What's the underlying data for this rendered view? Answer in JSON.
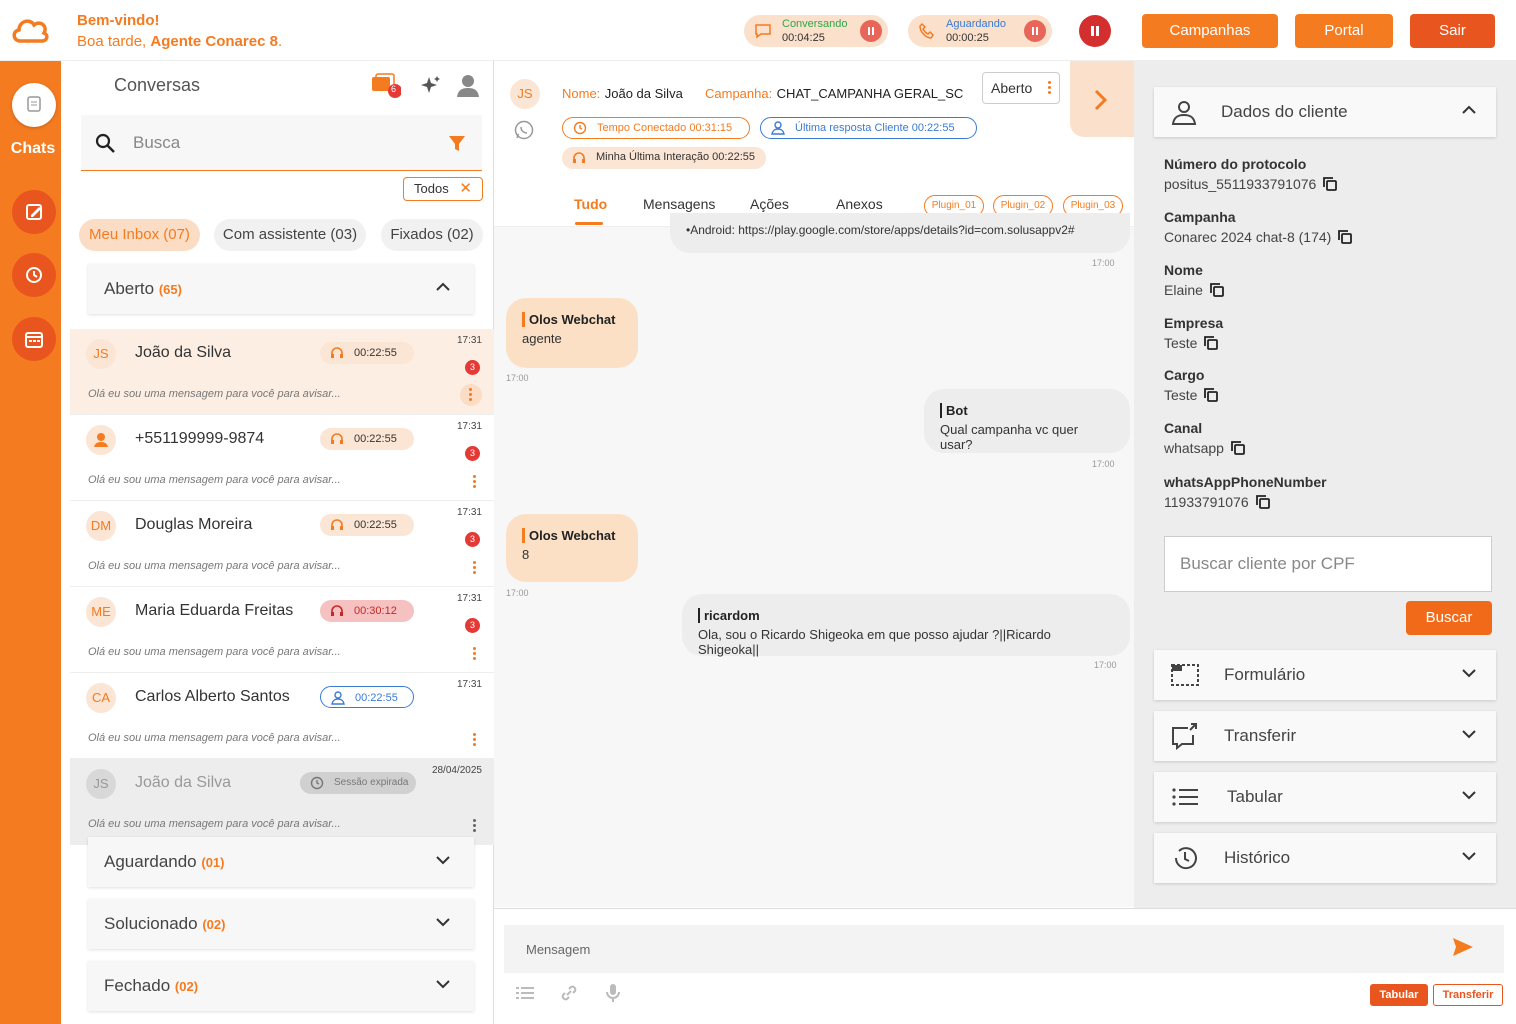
{
  "header": {
    "welcome": "Bem-vindo!",
    "greeting_prefix": "Boa tarde, ",
    "agent_name": "Agente Conarec 8",
    "greeting_suffix": ".",
    "status_chatting_label": "Conversando",
    "status_chatting_time": "00:04:25",
    "status_waiting_label": "Aguardando",
    "status_waiting_time": "00:00:25",
    "btn_campaigns": "Campanhas",
    "btn_portal": "Portal",
    "btn_exit": "Sair"
  },
  "rail": {
    "chats_label": "Chats"
  },
  "conversations": {
    "title": "Conversas",
    "notif_count": "6",
    "search_placeholder": "Busca",
    "filter_chip": "Todos",
    "tabs": [
      "Meu Inbox (07)",
      "Com assistente (03)",
      "Fixados (02)"
    ],
    "sections": [
      {
        "label": "Aberto",
        "count": "(65)"
      },
      {
        "label": "Aguardando",
        "count": "(01)"
      },
      {
        "label": "Solucionado",
        "count": "(02)"
      },
      {
        "label": "Fechado",
        "count": "(02)"
      }
    ],
    "items": [
      {
        "initials": "JS",
        "name": "João da Silva",
        "timer": "00:22:55",
        "time": "17:31",
        "badge": "3",
        "msg": "Olá eu sou uma mensagem para você para avisar..."
      },
      {
        "initials": "",
        "name": "+551199999-9874",
        "timer": "00:22:55",
        "time": "17:31",
        "badge": "3",
        "msg": "Olá eu sou uma mensagem para você para avisar..."
      },
      {
        "initials": "DM",
        "name": "Douglas Moreira",
        "timer": "00:22:55",
        "time": "17:31",
        "badge": "3",
        "msg": "Olá eu sou uma mensagem para você para avisar..."
      },
      {
        "initials": "ME",
        "name": "Maria Eduarda Freitas",
        "timer": "00:30:12",
        "time": "17:31",
        "badge": "3",
        "msg": "Olá eu sou uma mensagem para você para avisar..."
      },
      {
        "initials": "CA",
        "name": "Carlos Alberto Santos",
        "timer": "00:22:55",
        "time": "17:31",
        "badge": "",
        "msg": "Olá eu sou uma mensagem para você para avisar..."
      },
      {
        "initials": "JS",
        "name": "João da Silva",
        "timer": "Sessão expirada",
        "time": "28/04/2025",
        "badge": "",
        "msg": "Olá eu sou uma mensagem para você para avisar..."
      }
    ]
  },
  "chat": {
    "initials": "JS",
    "name_label": "Nome:",
    "name_value": "João da Silva",
    "campaign_label": "Campanha:",
    "campaign_value": "CHAT_CAMPANHA GERAL_SC",
    "status": "Aberto",
    "pill_connected": "Tempo Conectado 00:31:15",
    "pill_last_reply": "Última resposta Cliente 00:22:55",
    "pill_last_interaction": "Minha Última Interação 00:22:55",
    "tabs": [
      "Tudo",
      "Mensagens",
      "Ações",
      "Anexos"
    ],
    "plugins": [
      "Plugin_01",
      "Plugin_02",
      "Plugin_03"
    ],
    "top_cut_text": "•Android: https://play.google.com/store/apps/details?id=com.solusappv2#",
    "messages": [
      {
        "sender": "Olos Webchat",
        "text": "agente",
        "time": "17:00"
      },
      {
        "sender": "Bot",
        "text": "Qual campanha vc quer usar?",
        "time": "17:00"
      },
      {
        "sender": "Olos Webchat",
        "text": "8",
        "time": "17:00"
      },
      {
        "sender": "ricardom",
        "text": "Ola, sou o Ricardo Shigeoka em que posso ajudar ?||Ricardo Shigeoka||",
        "time": "17:00"
      }
    ],
    "first_time": "17:00",
    "composer_placeholder": "Mensagem",
    "btn_tabular": "Tabular",
    "btn_transferir": "Transferir"
  },
  "client": {
    "title": "Dados do cliente",
    "fields": [
      {
        "label": "Número do protocolo",
        "value": "positus_5511933791076"
      },
      {
        "label": "Campanha",
        "value": "Conarec 2024 chat-8 (174)"
      },
      {
        "label": "Nome",
        "value": "Elaine"
      },
      {
        "label": "Empresa",
        "value": "Teste"
      },
      {
        "label": "Cargo",
        "value": "Teste"
      },
      {
        "label": "Canal",
        "value": "whatsapp"
      },
      {
        "label": "whatsAppPhoneNumber",
        "value": "11933791076"
      }
    ],
    "cpf_placeholder": "Buscar cliente por CPF",
    "btn_search": "Buscar",
    "sections": [
      "Formulário",
      "Transferir",
      "Tabular",
      "Histórico"
    ]
  },
  "colors": {
    "accent": "#f47b20",
    "danger": "#d32f2f"
  }
}
